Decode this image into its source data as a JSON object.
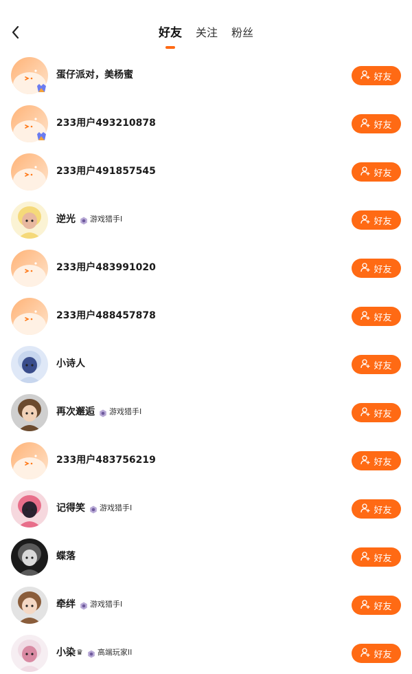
{
  "header": {
    "tabs": [
      {
        "label": "好友",
        "active": true
      },
      {
        "label": "关注",
        "active": false
      },
      {
        "label": "粉丝",
        "active": false
      }
    ]
  },
  "add_button_label": "好友",
  "colors": {
    "accent": "#ff6a14"
  },
  "friends": [
    {
      "name": "蛋仔派对，美杨蜜",
      "avatar": "default",
      "badge": true,
      "title": ""
    },
    {
      "name": "233用户493210878",
      "avatar": "default",
      "badge": true,
      "title": ""
    },
    {
      "name": "233用户491857545",
      "avatar": "default",
      "badge": false,
      "title": ""
    },
    {
      "name": "逆光",
      "avatar": "chibi-blonde",
      "badge": false,
      "title": "游戏猎手I"
    },
    {
      "name": "233用户483991020",
      "avatar": "default",
      "badge": false,
      "title": ""
    },
    {
      "name": "233用户488457878",
      "avatar": "default",
      "badge": false,
      "title": ""
    },
    {
      "name": "小诗人",
      "avatar": "anime-white-hair",
      "badge": false,
      "title": ""
    },
    {
      "name": "再次邂逅",
      "avatar": "anime-brown-hair",
      "badge": false,
      "title": "游戏猎手I"
    },
    {
      "name": "233用户483756219",
      "avatar": "default",
      "badge": false,
      "title": ""
    },
    {
      "name": "记得笑",
      "avatar": "anime-pink-cat",
      "badge": false,
      "title": "游戏猎手I"
    },
    {
      "name": "蝶落",
      "avatar": "dark-portrait",
      "badge": false,
      "title": ""
    },
    {
      "name": "牵绊",
      "avatar": "anime-girl",
      "badge": false,
      "title": "游戏猎手I"
    },
    {
      "name": "小染",
      "avatar": "anime-white-girl",
      "badge": false,
      "title": "高端玩家II",
      "crown": "♛"
    }
  ]
}
